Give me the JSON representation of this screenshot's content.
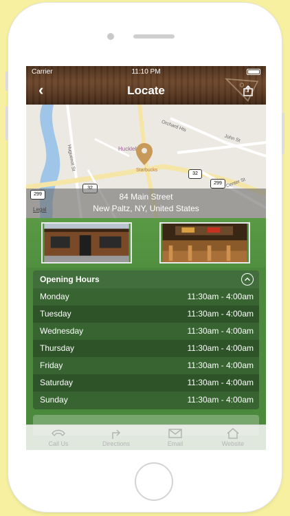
{
  "status_bar": {
    "carrier": "Carrier",
    "time": "11:10 PM"
  },
  "nav": {
    "back_icon": "‹",
    "title": "Locate"
  },
  "map": {
    "address_line1": "84 Main Street",
    "address_line2": "New Paltz, NY, United States",
    "legal": "Legal",
    "streets": [
      "Orchard Hts",
      "John St",
      "Huguenot St",
      "W Center St",
      "Starbucks",
      "Huckleberry"
    ],
    "route_shields": [
      "32",
      "299",
      "299",
      "32"
    ]
  },
  "opening_hours": {
    "title": "Opening Hours",
    "days": [
      {
        "day": "Monday",
        "hours": "11:30am - 4:00am"
      },
      {
        "day": "Tuesday",
        "hours": "11:30am - 4:00am"
      },
      {
        "day": "Wednesday",
        "hours": "11:30am - 4:00am"
      },
      {
        "day": "Thursday",
        "hours": "11:30am - 4:00am"
      },
      {
        "day": "Friday",
        "hours": "11:30am - 4:00am"
      },
      {
        "day": "Saturday",
        "hours": "11:30am - 4:00am"
      },
      {
        "day": "Sunday",
        "hours": "11:30am - 4:00am"
      }
    ]
  },
  "tabs": [
    {
      "label": "Call Us",
      "icon": "phone-icon"
    },
    {
      "label": "Directions",
      "icon": "directions-icon"
    },
    {
      "label": "Email",
      "icon": "email-icon"
    },
    {
      "label": "Website",
      "icon": "home-icon"
    }
  ],
  "colors": {
    "accent_green": "#4b8a3c",
    "wood_brown": "#5a3a22",
    "pin": "#c79a5a"
  }
}
